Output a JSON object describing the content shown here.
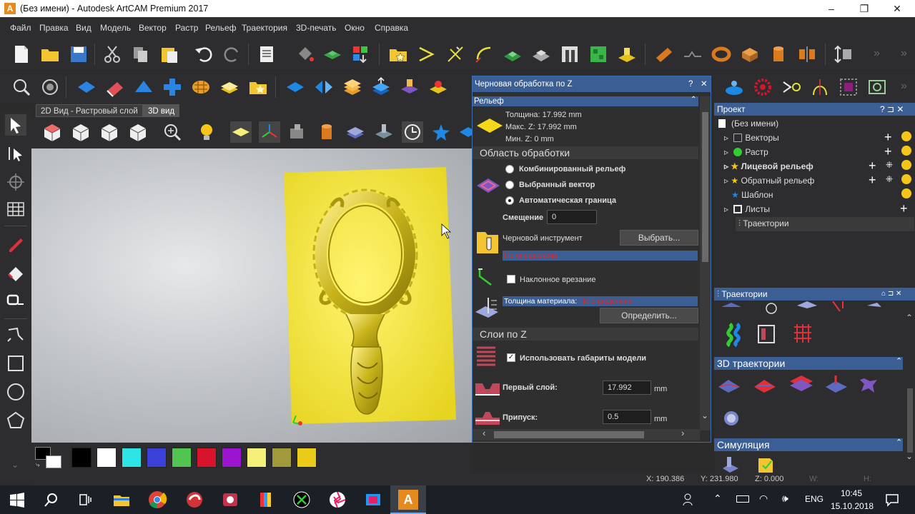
{
  "window": {
    "title": "(Без имени) - Autodesk ArtCAM Premium 2017",
    "logo": "A",
    "min": "–",
    "max": "❐",
    "close": "✕"
  },
  "menu": [
    "Файл",
    "Правка",
    "Вид",
    "Модель",
    "Вектор",
    "Растр",
    "Рельеф",
    "Траектория",
    "3D-печать",
    "Окно",
    "Справка"
  ],
  "tabs": {
    "t2d": "2D Вид - Растровый слой",
    "t3d": "3D вид"
  },
  "rough": {
    "title": "Черновая обработка по Z",
    "help": "?",
    "close": "✕",
    "relief_header": "Рельеф",
    "thickness": "Толщина:  17.992 mm",
    "maxz": "Макс. Z:    17.992 mm",
    "minz": "Мин. Z:      0 mm",
    "area_header": "Область обработки",
    "opt_combined": "Комбинированный рельеф",
    "opt_vector": "Выбранный вектор",
    "opt_auto": "Автоматическая граница",
    "offset_label": "Смещение",
    "offset_value": "0",
    "tool_label": "Черновой инструмент",
    "select_btn": "Выбрать...",
    "tool_undefined": "Не определена",
    "ramp_label": "Наклонное врезание",
    "material_label": "Толщина материала:",
    "material_undefined": "Не определена",
    "define_btn": "Определить...",
    "zlayers_header": "Слои по Z",
    "use_model": "Использовать габариты модели",
    "first_layer_label": "Первый слой:",
    "first_layer_value": "17.992",
    "allowance_label": "Припуск:",
    "allowance_value": "0.5",
    "unit": "mm"
  },
  "project": {
    "title": "Проект",
    "help": "? ⊐ ✕",
    "root": "(Без имени)",
    "items": [
      "Векторы",
      "Растр",
      "Лицевой рельеф",
      "Обратный рельеф",
      "Шаблон",
      "Листы",
      "Траектории"
    ]
  },
  "toolpaths": {
    "title": "Траектории",
    "header3d": "3D траектории",
    "sim": "Симуляция"
  },
  "status": {
    "x": "X: 190.386",
    "y": "Y: 231.980",
    "z": "Z: 0.000",
    "w": "W:",
    "h": "H:"
  },
  "taskbar": {
    "lang": "ENG",
    "time": "10:45",
    "date": "15.10.2018"
  },
  "colors": {
    "swatches": [
      "#000000",
      "#ffffff",
      "#2ee5e5",
      "#3a40d8",
      "#52c452",
      "#d8142a",
      "#9b14d0",
      "#f5f07a",
      "#a09a3a",
      "#eacb1a"
    ],
    "accent": "#3b5f94"
  }
}
